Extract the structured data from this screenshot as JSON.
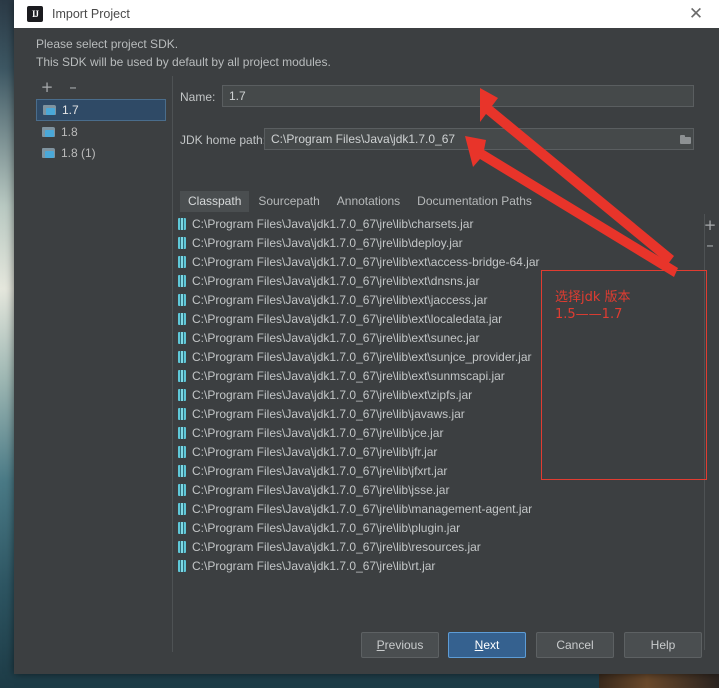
{
  "window": {
    "title": "Import Project",
    "app_icon": "intellij-idea-icon",
    "close_icon": "close-icon"
  },
  "hints": {
    "line1": "Please select project SDK.",
    "line2": "This SDK will be used by default by all project modules."
  },
  "sdk_toolbar": {
    "add_label": "+",
    "remove_label": "–"
  },
  "sdk_list": [
    {
      "label": "1.7",
      "selected": true
    },
    {
      "label": "1.8",
      "selected": false
    },
    {
      "label": "1.8 (1)",
      "selected": false
    }
  ],
  "fields": {
    "name_label": "Name:",
    "name_value": "1.7",
    "jdk_label": "JDK home path:",
    "jdk_value": "C:\\Program Files\\Java\\jdk1.7.0_67",
    "browse_icon": "folder-icon"
  },
  "tabs": [
    {
      "label": "Classpath",
      "active": true
    },
    {
      "label": "Sourcepath",
      "active": false
    },
    {
      "label": "Annotations",
      "active": false
    },
    {
      "label": "Documentation Paths",
      "active": false
    }
  ],
  "classpath_side_buttons": {
    "add_label": "+",
    "remove_label": "–"
  },
  "classpath": [
    "C:\\Program Files\\Java\\jdk1.7.0_67\\jre\\lib\\charsets.jar",
    "C:\\Program Files\\Java\\jdk1.7.0_67\\jre\\lib\\deploy.jar",
    "C:\\Program Files\\Java\\jdk1.7.0_67\\jre\\lib\\ext\\access-bridge-64.jar",
    "C:\\Program Files\\Java\\jdk1.7.0_67\\jre\\lib\\ext\\dnsns.jar",
    "C:\\Program Files\\Java\\jdk1.7.0_67\\jre\\lib\\ext\\jaccess.jar",
    "C:\\Program Files\\Java\\jdk1.7.0_67\\jre\\lib\\ext\\localedata.jar",
    "C:\\Program Files\\Java\\jdk1.7.0_67\\jre\\lib\\ext\\sunec.jar",
    "C:\\Program Files\\Java\\jdk1.7.0_67\\jre\\lib\\ext\\sunjce_provider.jar",
    "C:\\Program Files\\Java\\jdk1.7.0_67\\jre\\lib\\ext\\sunmscapi.jar",
    "C:\\Program Files\\Java\\jdk1.7.0_67\\jre\\lib\\ext\\zipfs.jar",
    "C:\\Program Files\\Java\\jdk1.7.0_67\\jre\\lib\\javaws.jar",
    "C:\\Program Files\\Java\\jdk1.7.0_67\\jre\\lib\\jce.jar",
    "C:\\Program Files\\Java\\jdk1.7.0_67\\jre\\lib\\jfr.jar",
    "C:\\Program Files\\Java\\jdk1.7.0_67\\jre\\lib\\jfxrt.jar",
    "C:\\Program Files\\Java\\jdk1.7.0_67\\jre\\lib\\jsse.jar",
    "C:\\Program Files\\Java\\jdk1.7.0_67\\jre\\lib\\management-agent.jar",
    "C:\\Program Files\\Java\\jdk1.7.0_67\\jre\\lib\\plugin.jar",
    "C:\\Program Files\\Java\\jdk1.7.0_67\\jre\\lib\\resources.jar",
    "C:\\Program Files\\Java\\jdk1.7.0_67\\jre\\lib\\rt.jar"
  ],
  "buttons": {
    "previous": "Previous",
    "previous_mnemonic": "P",
    "previous_rest": "revious",
    "next": "Next",
    "next_mnemonic": "N",
    "next_rest": "ext",
    "cancel": "Cancel",
    "help": "Help"
  },
  "annotation": {
    "line1": "选择jdk 版本",
    "line2": "1.5——1.7",
    "color": "#e03c31"
  },
  "colors": {
    "dialog_bg": "#3c3f41",
    "field_bg": "#45494a",
    "selection_blue": "#2f4a66",
    "primary_button": "#35618f",
    "annotation_red": "#e03c31",
    "titlebar_bg": "#ffffff"
  }
}
